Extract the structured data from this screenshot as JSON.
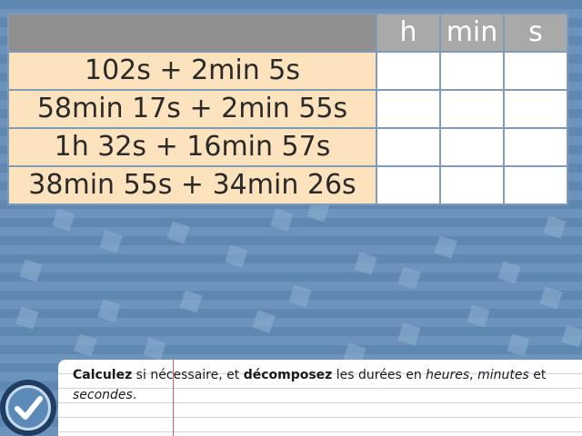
{
  "table": {
    "units": [
      "h",
      "min",
      "s"
    ],
    "rows": [
      {
        "expression": "102s + 2min 5s"
      },
      {
        "expression": "58min 17s + 2min 55s"
      },
      {
        "expression": "1h 32s + 16min 57s"
      },
      {
        "expression": "38min 55s + 34min 26s"
      }
    ]
  },
  "instruction": {
    "bold1": "Calculez",
    "text1": " si nécessaire, et ",
    "bold2": "décomposez",
    "text2": " les durées en ",
    "italic1": "heures",
    "text3": ", ",
    "italic2": "minutes",
    "text4": " et ",
    "italic3": "secondes",
    "text5": "."
  },
  "icons": {
    "validate": "check-icon"
  },
  "colors": {
    "expression_bg": "#fde3bd",
    "header_bg": "#8f8f8f",
    "unit_header_bg": "#a9a9a9",
    "background": "#5f88b1"
  }
}
